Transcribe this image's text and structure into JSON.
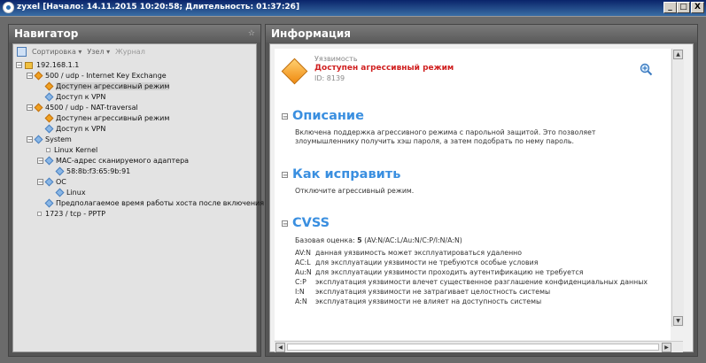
{
  "window": {
    "title": "zyxel [Начало: 14.11.2015 10:20:58; Длительность: 01:37:26]",
    "min_label": "_",
    "max_label": "□",
    "close_label": "X"
  },
  "navigator": {
    "title": "Навигатор",
    "pin": "☆",
    "toolbar": {
      "sort": "Сортировка ▾",
      "node": "Узел ▾",
      "log": "Журнал"
    },
    "tree": [
      {
        "label": "192.168.1.1"
      },
      {
        "label": "500 / udp - Internet Key Exchange"
      },
      {
        "label": "Доступен агрессивный режим"
      },
      {
        "label": "Доступ к VPN"
      },
      {
        "label": "4500 / udp - NAT-traversal"
      },
      {
        "label": "Доступен агрессивный режим"
      },
      {
        "label": "Доступ к VPN"
      },
      {
        "label": "System"
      },
      {
        "label": "Linux Kernel"
      },
      {
        "label": "MAC-адрес сканируемого адаптера"
      },
      {
        "label": "58:8b:f3:65:9b:91"
      },
      {
        "label": "ОС"
      },
      {
        "label": "Linux"
      },
      {
        "label": "Предполагаемое время работы хоста после включения"
      },
      {
        "label": "1723 / tcp - PPTP"
      }
    ]
  },
  "info": {
    "title": "Информация",
    "vuln": {
      "category": "Уязвимость",
      "title": "Доступен агрессивный режим",
      "id": "ID: 8139"
    },
    "description": {
      "heading": "Описание",
      "text": "Включена поддержка агрессивного режима с парольной защитой. Это позволяет злоумышленнику получить хэш пароля, а затем подобрать по нему пароль."
    },
    "fix": {
      "heading": "Как исправить",
      "text": "Отключите агрессивный режим."
    },
    "cvss": {
      "heading": "CVSS",
      "base_label": "Базовая оценка:",
      "base_score": "5",
      "vector": "(AV:N/AC:L/Au:N/C:P/I:N/A:N)",
      "rows": [
        {
          "k": "AV:N",
          "v": "данная уязвимость может эксплуатироваться удаленно"
        },
        {
          "k": "AC:L",
          "v": "для эксплуатации уязвимости не требуются особые условия"
        },
        {
          "k": "Au:N",
          "v": "для эксплуатации уязвимости проходить аутентификацию не требуется"
        },
        {
          "k": "C:P",
          "v": "эксплуатация уязвимости влечет существенное разглашение конфиденциальных данных"
        },
        {
          "k": "I:N",
          "v": "эксплуатация уязвимости не затрагивает целостность системы"
        },
        {
          "k": "A:N",
          "v": "эксплуатация уязвимости не влияет на доступность системы"
        }
      ]
    }
  },
  "colors": {
    "accent": "#3a8fe0",
    "vuln_title": "#d02020",
    "titlebar": "#0a246a"
  }
}
